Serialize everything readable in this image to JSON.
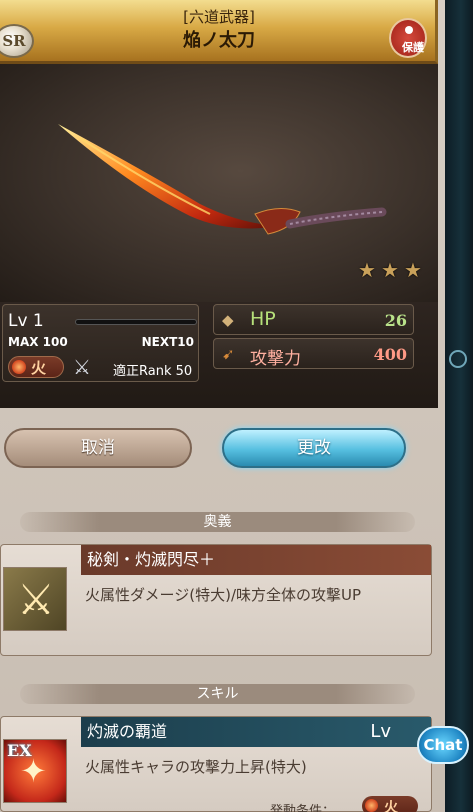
{
  "header": {
    "rarity": "SR",
    "category": "[六道武器]",
    "weapon_name": "焔ノ太刀",
    "lock_label": "保護"
  },
  "stars": [
    "★",
    "★",
    "★"
  ],
  "level": {
    "lv": "Lv 1",
    "max": "MAX 100",
    "next": "NEXT10",
    "element": "火",
    "weapon_type_icon": "crossed-swords",
    "rank_req": "適正Rank 50"
  },
  "stats": {
    "hp_label": "HP",
    "hp_value": "26",
    "atk_label": "攻撃力",
    "atk_value": "400"
  },
  "buttons": {
    "cancel": "取消",
    "change": "更改"
  },
  "ougi": {
    "section_label": "奥義",
    "name": "秘剣・灼滅閃尽＋",
    "description": "火属性ダメージ(特大)/味方全体の攻撃UP"
  },
  "skill": {
    "section_label": "スキル",
    "name": "灼滅の覇道",
    "lv_label": "Lv",
    "ex_label": "EX",
    "description": "火属性キャラの攻撃力上昇(特大)",
    "condition_label": "発動条件：",
    "condition_element": "火"
  },
  "chat": "Chat",
  "colors": {
    "accent_gold": "#d8a945",
    "hp_green": "#b9e28a",
    "atk_red": "#ff9a86",
    "change_blue": "#56bfe0"
  }
}
